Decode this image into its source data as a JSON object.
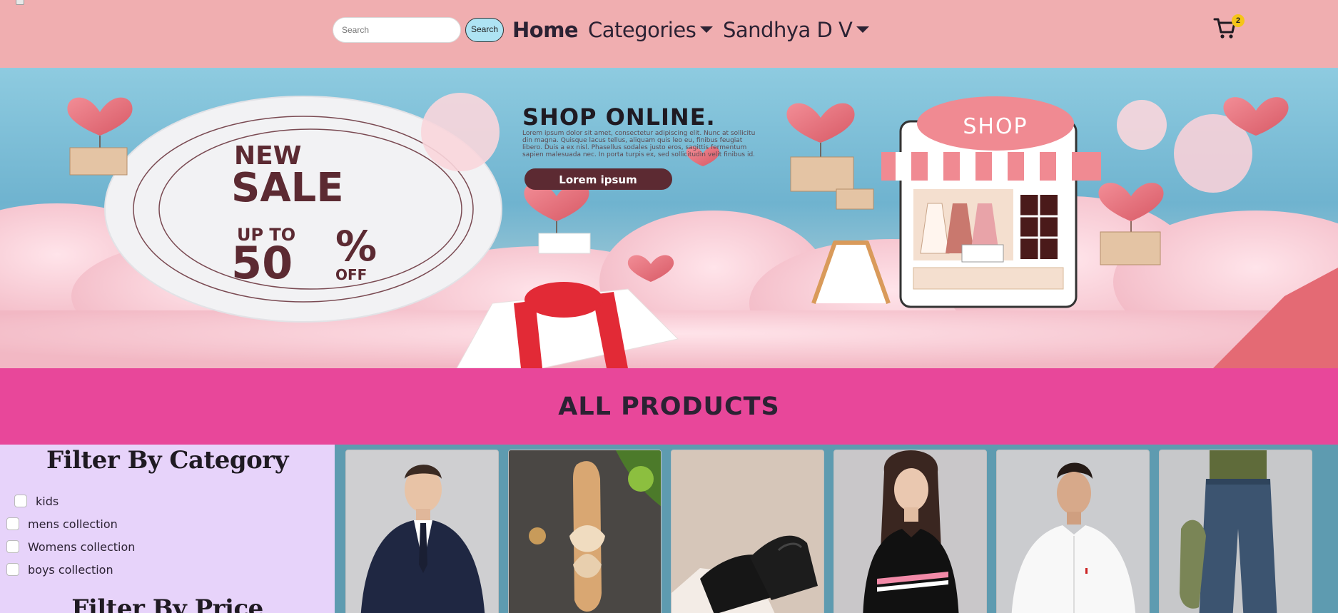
{
  "navbar": {
    "search": {
      "placeholder": "Search",
      "value": ""
    },
    "search_button_label": "Search",
    "links": {
      "home": "Home",
      "categories": "Categories",
      "user": "Sandhya D V"
    },
    "cart_count": "2",
    "cart_icon": "shopping-cart-icon"
  },
  "banner": {
    "headline": "SHOP ONLINE.",
    "body_text": [
      "Lorem ipsum dolor sit amet, consectetur adipiscing elit. Nunc at sollicitu",
      "din magna. Quisque lacus tellus, aliquam quis leo eu, finibus feugiat",
      "libero. Duis a ex nisl. Phasellus sodales justo eros, sagittis fermentum",
      "sapien malesuada nec. In porta turpis ex, sed sollicitudin velit finibus id."
    ],
    "button_label": "Lorem ipsum",
    "sale_new": "NEW",
    "sale_sale": "SALE",
    "sale_upto": "UP TO",
    "sale_percent_number": "50",
    "sale_percent_sign": "%",
    "sale_off": "OFF",
    "shop_sign": "SHOP"
  },
  "section_title": "ALL PRODUCTS",
  "filters": {
    "category_title": "Filter By Category",
    "categories": [
      {
        "label": "kids",
        "checked": false
      },
      {
        "label": "mens collection",
        "checked": false
      },
      {
        "label": "Womens collection",
        "checked": false
      },
      {
        "label": "boys collection",
        "checked": false
      }
    ],
    "price_title": "Filter By Price"
  },
  "products": [
    {
      "image": "man-in-navy-suit"
    },
    {
      "image": "beige-bow-sandal"
    },
    {
      "image": "black-formal-shoes"
    },
    {
      "image": "woman-black-printed-tshirt"
    },
    {
      "image": "man-white-shirt"
    },
    {
      "image": "blue-denim-jeans"
    }
  ],
  "colors": {
    "navbar_bg": "#f0aeb0",
    "section_bg": "#e8479a",
    "sidebar_bg": "#e7d3fa",
    "products_bg": "#5e9bb0",
    "search_button_bg": "#aee3f3",
    "cart_badge": "#f5c518"
  }
}
